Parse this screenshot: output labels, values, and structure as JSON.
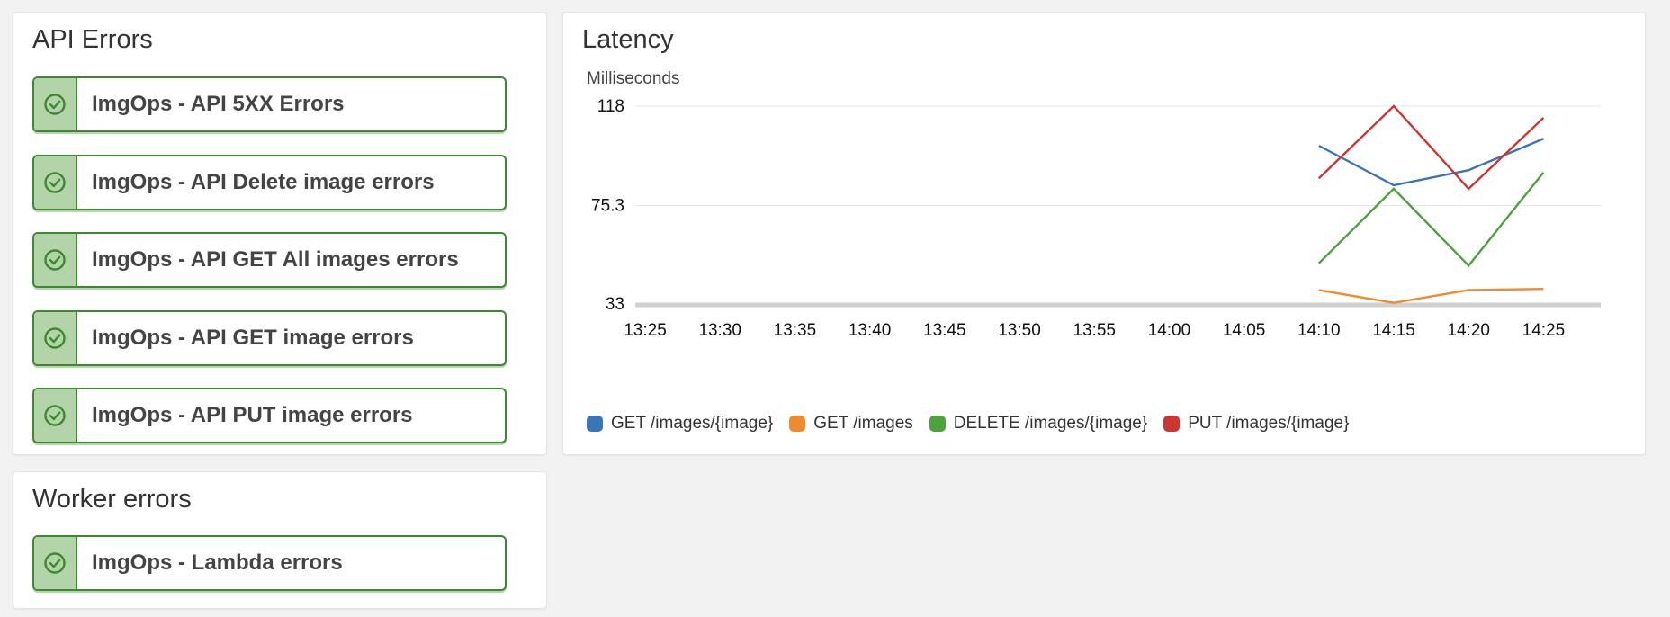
{
  "api_errors": {
    "title": "API Errors",
    "alarms": [
      {
        "label": "ImgOps - API 5XX Errors",
        "state": "ok",
        "icon": "check-circle-icon"
      },
      {
        "label": "ImgOps - API Delete image errors",
        "state": "ok",
        "icon": "check-circle-icon"
      },
      {
        "label": "ImgOps - API GET All images errors",
        "state": "ok",
        "icon": "check-circle-icon"
      },
      {
        "label": "ImgOps - API GET image errors",
        "state": "ok",
        "icon": "check-circle-icon"
      },
      {
        "label": "ImgOps - API PUT image errors",
        "state": "ok",
        "icon": "check-circle-icon"
      }
    ]
  },
  "worker_errors": {
    "title": "Worker errors",
    "alarms": [
      {
        "label": "ImgOps - Lambda errors",
        "state": "ok",
        "icon": "check-circle-icon"
      }
    ]
  },
  "latency": {
    "title": "Latency",
    "unit": "Milliseconds"
  },
  "colors": {
    "ok_green": "#3b8a2e",
    "ok_fill": "#b3d4a8"
  },
  "chart_data": {
    "type": "line",
    "title": "Latency",
    "ylabel": "Milliseconds",
    "xlabel": "",
    "ylim": [
      33,
      118
    ],
    "y_ticks": [
      "118",
      "75.3",
      "33"
    ],
    "categories": [
      "13:25",
      "13:30",
      "13:35",
      "13:40",
      "13:45",
      "13:50",
      "13:55",
      "14:00",
      "14:05",
      "14:10",
      "14:15",
      "14:20",
      "14:25"
    ],
    "series": [
      {
        "name": "GET /images/{image}",
        "color": "#3a76b7",
        "values": [
          null,
          null,
          null,
          null,
          null,
          null,
          null,
          null,
          null,
          101,
          84,
          90.5,
          104
        ]
      },
      {
        "name": "GET /images",
        "color": "#f08a2c",
        "values": [
          null,
          null,
          null,
          null,
          null,
          null,
          null,
          null,
          null,
          39,
          33.5,
          39,
          39.5
        ]
      },
      {
        "name": "DELETE /images/{image}",
        "color": "#4aa33b",
        "values": [
          null,
          null,
          null,
          null,
          null,
          null,
          null,
          null,
          null,
          50.5,
          82.5,
          49.5,
          89.5
        ]
      },
      {
        "name": "PUT /images/{image}",
        "color": "#cf3530",
        "values": [
          null,
          null,
          null,
          null,
          null,
          null,
          null,
          null,
          null,
          87,
          118,
          82.5,
          113
        ]
      }
    ],
    "grid": true,
    "legend_position": "bottom-left"
  }
}
